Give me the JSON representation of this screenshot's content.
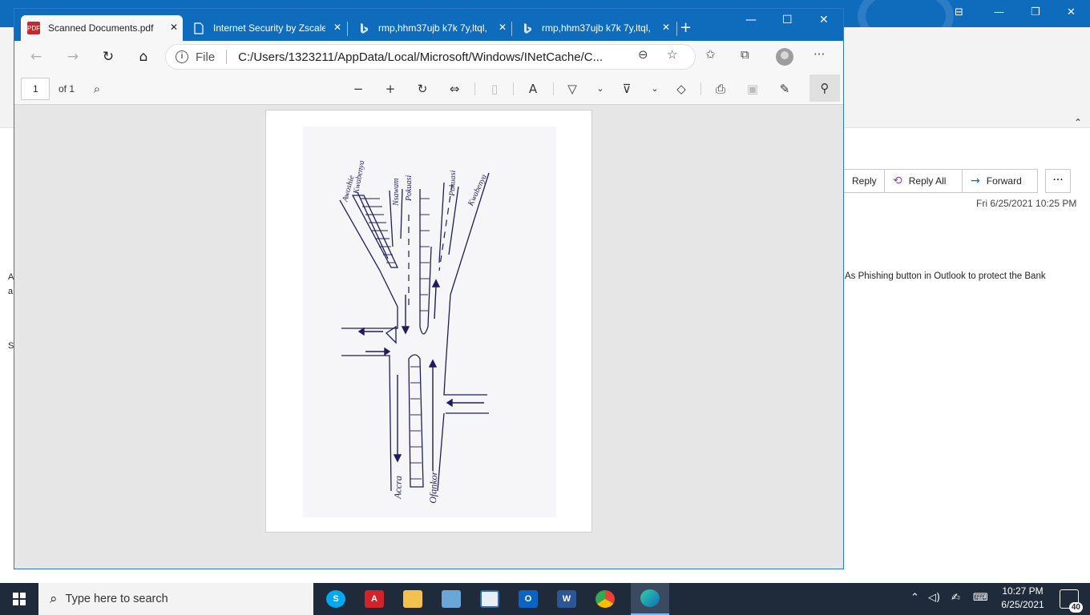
{
  "outlook": {
    "actions": [
      {
        "label": "Reply",
        "icon": ""
      },
      {
        "label": "Reply All",
        "icon": "⟲"
      },
      {
        "label": "Forward",
        "icon": "→"
      }
    ],
    "more_label": "···",
    "date": "Fri 6/25/2021 10:25 PM",
    "body_text": "As Phishing button in Outlook to protect the Bank",
    "left_edge_chars": [
      "A",
      "a",
      "S"
    ]
  },
  "browser": {
    "tabs": [
      {
        "title": "Scanned Documents.pdf",
        "icon": "pdf-icon",
        "active": true
      },
      {
        "title": "Internet Security by Zscaler",
        "icon": "page-icon",
        "active": false
      },
      {
        "title": "rmp,hhm37ujb k7k 7y,ltql,",
        "icon": "bing-icon",
        "active": false
      },
      {
        "title": "rmp,hhm37ujb k7k 7y,ltql,",
        "icon": "bing-icon",
        "active": false
      }
    ],
    "address": {
      "protocol": "File",
      "url": "C:/Users/1323211/AppData/Local/Microsoft/Windows/INetCache/C..."
    },
    "pdf": {
      "page": "1",
      "of_pages": "of 1"
    }
  },
  "sketch": {
    "labels": {
      "top_left_1": "Awoshie",
      "top_left_2": "Kwabenya",
      "top_mid_1": "Nsawam",
      "top_mid_2": "Pokuasi",
      "top_right_1": "Pokuasi",
      "top_right_2": "Kwabenya",
      "bottom_left": "Accra",
      "bottom_right": "Ofankor"
    }
  },
  "taskbar": {
    "search_placeholder": "Type here to search",
    "time": "10:27 PM",
    "date": "6/25/2021",
    "notification_count": "40"
  },
  "colors": {
    "accent": "#0f6cbd",
    "ink": "#1e1c5c",
    "taskbar": "#1f2a3a"
  }
}
